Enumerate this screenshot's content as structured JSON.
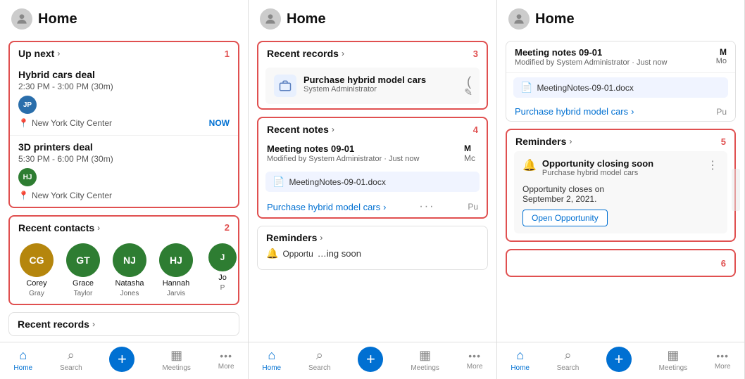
{
  "panels": [
    {
      "id": "panel1",
      "header": {
        "title": "Home"
      },
      "sections": [
        {
          "id": "up-next",
          "title": "Up next",
          "number": "1",
          "events": [
            {
              "title": "Hybrid cars deal",
              "time": "2:30 PM - 3:00 PM (30m)",
              "badge": "JP",
              "badge_color": "#2a6eab",
              "location": "New York City Center",
              "now": "NOW"
            },
            {
              "title": "3D printers deal",
              "time": "5:30 PM - 6:00 PM (30m)",
              "badge": "HJ",
              "badge_color": "#2e7d32",
              "location": "New York City Center",
              "now": ""
            }
          ]
        },
        {
          "id": "recent-contacts",
          "title": "Recent contacts",
          "number": "2",
          "contacts": [
            {
              "initials": "CG",
              "first": "Corey",
              "last": "Gray",
              "color": "#b5860d"
            },
            {
              "initials": "GT",
              "first": "Grace",
              "last": "Taylor",
              "color": "#2e7d32"
            },
            {
              "initials": "NJ",
              "first": "Natasha",
              "last": "Jones",
              "color": "#2e7d32"
            },
            {
              "initials": "HJ",
              "first": "Hannah",
              "last": "Jarvis",
              "color": "#2e7d32"
            },
            {
              "initials": "J",
              "first": "Jo",
              "last": "P",
              "color": "#2e7d32"
            }
          ]
        }
      ],
      "partial_section_title": "Recent records",
      "nav": {
        "items": [
          {
            "label": "Home",
            "icon": "⌂",
            "active": true
          },
          {
            "label": "Search",
            "icon": "⌕",
            "active": false
          },
          {
            "label": "",
            "icon": "+",
            "fab": true
          },
          {
            "label": "Meetings",
            "icon": "▦",
            "active": false
          },
          {
            "label": "More",
            "icon": "···",
            "active": false
          }
        ]
      }
    },
    {
      "id": "panel2",
      "header": {
        "title": "Home"
      },
      "sections": [
        {
          "id": "recent-records",
          "title": "Recent records",
          "number": "3",
          "record": {
            "title": "Purchase hybrid model cars",
            "subtitle": "System Administrator",
            "icon": "briefcase"
          }
        },
        {
          "id": "recent-notes",
          "title": "Recent notes",
          "number": "4",
          "notes": [
            {
              "title": "Meeting notes 09-01",
              "meta": "Modified by System Administrator · Just now",
              "col_title": "M",
              "col_meta": "Mc"
            }
          ],
          "attachment": "MeetingNotes-09-01.docx",
          "link_text": "Purchase hybrid model cars",
          "link_more": "···",
          "partial_col": "Pu"
        }
      ],
      "reminder_section": {
        "title": "Reminders",
        "partial": true
      },
      "nav": {
        "items": [
          {
            "label": "Home",
            "icon": "⌂",
            "active": true
          },
          {
            "label": "Search",
            "icon": "⌕",
            "active": false
          },
          {
            "label": "",
            "icon": "+",
            "fab": true
          },
          {
            "label": "Meetings",
            "icon": "▦",
            "active": false
          },
          {
            "label": "More",
            "icon": "···",
            "active": false
          }
        ]
      }
    },
    {
      "id": "panel3",
      "header": {
        "title": "Home"
      },
      "sections": [
        {
          "id": "recent-notes-detail",
          "notes": [
            {
              "title": "Meeting notes 09-01",
              "meta": "Modified by System Administrator · Just now",
              "col_title": "M",
              "col_meta": "Mo"
            }
          ],
          "attachment": "MeetingNotes-09-01.docx",
          "link_text": "Purchase hybrid model cars",
          "partial_col": "Pu"
        },
        {
          "id": "reminders",
          "title": "Reminders",
          "number": "5",
          "reminder": {
            "title": "Opportunity closing soon",
            "subtitle": "Purchase hybrid model cars",
            "desc": "Opportunity closes on\nSeptember 2, 2021.",
            "btn": "Open Opportunity"
          }
        }
      ],
      "section6_number": "6",
      "nav": {
        "items": [
          {
            "label": "Home",
            "icon": "⌂",
            "active": true
          },
          {
            "label": "Search",
            "icon": "⌕",
            "active": false
          },
          {
            "label": "",
            "icon": "+",
            "fab": true
          },
          {
            "label": "Meetings",
            "icon": "▦",
            "active": false
          },
          {
            "label": "More",
            "icon": "···",
            "active": false
          }
        ]
      }
    }
  ],
  "nav_labels": {
    "home": "Home",
    "search": "Search",
    "meetings": "Meetings",
    "more": "More"
  }
}
